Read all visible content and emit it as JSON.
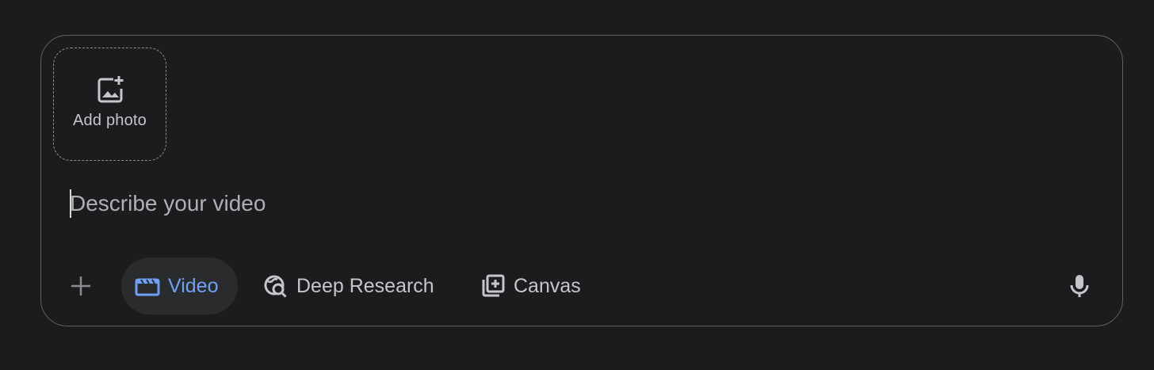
{
  "add_photo": {
    "label": "Add photo",
    "icon": "add-photo-icon"
  },
  "prompt": {
    "placeholder": "Describe your video",
    "value": ""
  },
  "toolbar": {
    "plus_icon": "plus-icon",
    "tools": [
      {
        "label": "Video",
        "icon": "video-clapper-icon",
        "active": true
      },
      {
        "label": "Deep Research",
        "icon": "deep-research-icon",
        "active": false
      },
      {
        "label": "Canvas",
        "icon": "canvas-icon",
        "active": false
      }
    ],
    "mic_icon": "microphone-icon"
  },
  "colors": {
    "background": "#1b1c1e",
    "active_accent": "#6ea0f5",
    "active_chip_bg": "#2a2b2d",
    "text_muted": "#c4c6ca",
    "border": "#5f6165"
  }
}
